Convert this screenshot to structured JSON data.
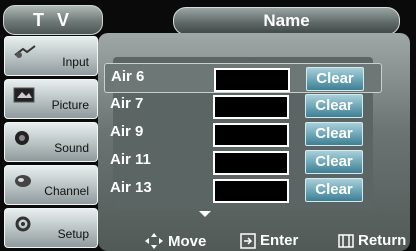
{
  "header": {
    "menu_title": "T V",
    "screen_title": "Name"
  },
  "sidebar": {
    "items": [
      {
        "label": "Input",
        "icon": "input-icon"
      },
      {
        "label": "Picture",
        "icon": "picture-icon"
      },
      {
        "label": "Sound",
        "icon": "sound-icon"
      },
      {
        "label": "Channel",
        "icon": "channel-icon"
      },
      {
        "label": "Setup",
        "icon": "setup-icon"
      }
    ]
  },
  "channels": [
    {
      "name": "Air 6",
      "value": "",
      "action": "Clear"
    },
    {
      "name": "Air 7",
      "value": "",
      "action": "Clear"
    },
    {
      "name": "Air 9",
      "value": "",
      "action": "Clear"
    },
    {
      "name": "Air 11",
      "value": "",
      "action": "Clear"
    },
    {
      "name": "Air 13",
      "value": "",
      "action": "Clear"
    }
  ],
  "footer": {
    "move": "Move",
    "enter": "Enter",
    "return": "Return"
  },
  "colors": {
    "accent": "#6aa4b5",
    "panel": "#6b7472",
    "sidebar": "#b8c2c3"
  }
}
